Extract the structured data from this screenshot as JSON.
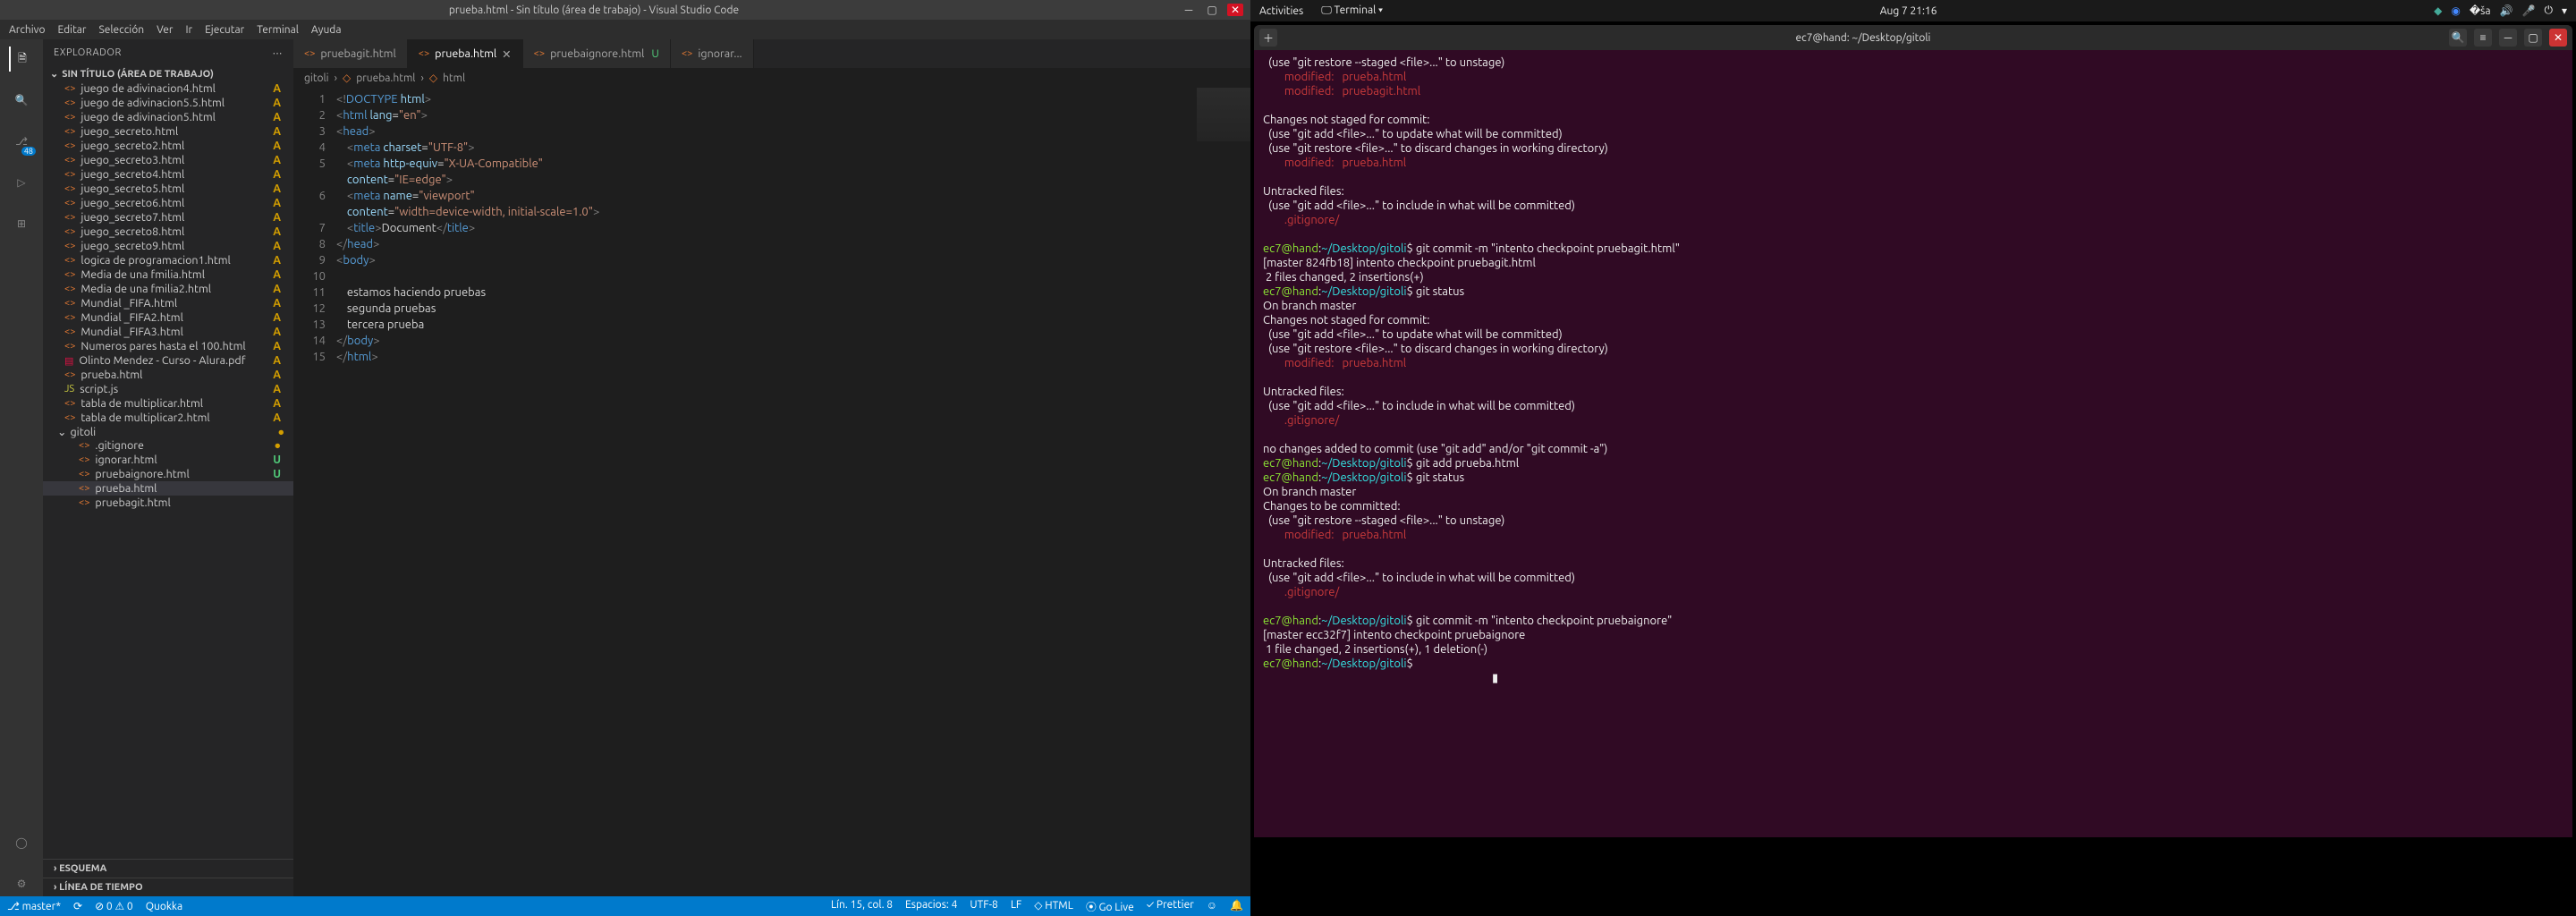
{
  "vscode": {
    "title": "prueba.html - Sin título (área de trabajo) - Visual Studio Code",
    "menus": [
      "Archivo",
      "Editar",
      "Selección",
      "Ver",
      "Ir",
      "Ejecutar",
      "Terminal",
      "Ayuda"
    ],
    "scm_badge": "48",
    "explorer_label": "EXPLORADOR",
    "workspace_label": "SIN TÍTULO (ÁREA DE TRABAJO)",
    "files": [
      {
        "name": "juego de adivinacion4.html",
        "status": "A"
      },
      {
        "name": "juego de adivinacion5.5.html",
        "status": "A"
      },
      {
        "name": "juego de adivinacion5.html",
        "status": "A"
      },
      {
        "name": "juego_secreto.html",
        "status": "A"
      },
      {
        "name": "juego_secreto2.html",
        "status": "A"
      },
      {
        "name": "juego_secreto3.html",
        "status": "A"
      },
      {
        "name": "juego_secreto4.html",
        "status": "A"
      },
      {
        "name": "juego_secreto5.html",
        "status": "A"
      },
      {
        "name": "juego_secreto6.html",
        "status": "A"
      },
      {
        "name": "juego_secreto7.html",
        "status": "A"
      },
      {
        "name": "juego_secreto8.html",
        "status": "A"
      },
      {
        "name": "juego_secreto9.html",
        "status": "A"
      },
      {
        "name": "logica de programacion1.html",
        "status": "A"
      },
      {
        "name": "Media de una fmilia.html",
        "status": "A"
      },
      {
        "name": "Media de una fmilia2.html",
        "status": "A"
      },
      {
        "name": "Mundial _FIFA.html",
        "status": "A"
      },
      {
        "name": "Mundial _FIFA2.html",
        "status": "A"
      },
      {
        "name": "Mundial _FIFA3.html",
        "status": "A"
      },
      {
        "name": "Numeros pares hasta el 100.html",
        "status": "A"
      },
      {
        "name": "Olinto Mendez - Curso - Alura.pdf",
        "status": "A",
        "icon": "pdf"
      },
      {
        "name": "prueba.html",
        "status": "A"
      },
      {
        "name": "script.js",
        "status": "A",
        "icon": "js"
      },
      {
        "name": "tabla de multiplicar.html",
        "status": "A"
      },
      {
        "name": "tabla de multiplicar2.html",
        "status": "A"
      }
    ],
    "gitoli_folder": "gitoli",
    "gitoli_files": [
      {
        "name": ".gitignore",
        "status": "●",
        "cls": "dot"
      },
      {
        "name": "ignorar.html",
        "status": "U",
        "cls": "U"
      },
      {
        "name": "pruebaignore.html",
        "status": "U",
        "cls": "U"
      },
      {
        "name": "prueba.html",
        "status": "",
        "selected": true
      },
      {
        "name": "pruebagit.html",
        "status": ""
      }
    ],
    "outline": "ESQUEMA",
    "timeline": "LÍNEA DE TIEMPO",
    "tabs": [
      {
        "label": "pruebagit.html",
        "active": false
      },
      {
        "label": "prueba.html",
        "active": true,
        "close": true
      },
      {
        "label": "pruebaignore.html",
        "mod": "U",
        "active": false
      },
      {
        "label": "ignorar...",
        "active": false
      }
    ],
    "breadcrumb": [
      "gitoli",
      "prueba.html",
      "html"
    ],
    "code_lines": [
      {
        "n": "1",
        "seg": [
          [
            "gray",
            "<!"
          ],
          [
            "blue",
            "DOCTYPE "
          ],
          [
            "lb",
            "html"
          ],
          [
            "gray",
            ">"
          ]
        ]
      },
      {
        "n": "2",
        "seg": [
          [
            "gray",
            "<"
          ],
          [
            "blue",
            "html "
          ],
          [
            "lb",
            "lang"
          ],
          [
            "txt",
            "="
          ],
          [
            "str",
            "\"en\""
          ],
          [
            "gray",
            ">"
          ]
        ]
      },
      {
        "n": "3",
        "seg": [
          [
            "gray",
            "<"
          ],
          [
            "blue",
            "head"
          ],
          [
            "gray",
            ">"
          ]
        ]
      },
      {
        "n": "4",
        "seg": [
          [
            "txt",
            "    "
          ],
          [
            "gray",
            "<"
          ],
          [
            "blue",
            "meta "
          ],
          [
            "lb",
            "charset"
          ],
          [
            "txt",
            "="
          ],
          [
            "str",
            "\"UTF-8\""
          ],
          [
            "gray",
            ">"
          ]
        ]
      },
      {
        "n": "5",
        "seg": [
          [
            "txt",
            "    "
          ],
          [
            "gray",
            "<"
          ],
          [
            "blue",
            "meta "
          ],
          [
            "lb",
            "http-equiv"
          ],
          [
            "txt",
            "="
          ],
          [
            "str",
            "\"X-UA-Compatible\""
          ]
        ]
      },
      {
        "n": "",
        "seg": [
          [
            "txt",
            "    "
          ],
          [
            "lb",
            "content"
          ],
          [
            "txt",
            "="
          ],
          [
            "str",
            "\"IE=edge\""
          ],
          [
            "gray",
            ">"
          ]
        ]
      },
      {
        "n": "6",
        "seg": [
          [
            "txt",
            "    "
          ],
          [
            "gray",
            "<"
          ],
          [
            "blue",
            "meta "
          ],
          [
            "lb",
            "name"
          ],
          [
            "txt",
            "="
          ],
          [
            "str",
            "\"viewport\""
          ]
        ]
      },
      {
        "n": "",
        "seg": [
          [
            "txt",
            "    "
          ],
          [
            "lb",
            "content"
          ],
          [
            "txt",
            "="
          ],
          [
            "str",
            "\"width=device-width, initial-scale=1.0\""
          ],
          [
            "gray",
            ">"
          ]
        ]
      },
      {
        "n": "7",
        "seg": [
          [
            "txt",
            "    "
          ],
          [
            "gray",
            "<"
          ],
          [
            "blue",
            "title"
          ],
          [
            "gray",
            ">"
          ],
          [
            "txt",
            "Document"
          ],
          [
            "gray",
            "</"
          ],
          [
            "blue",
            "title"
          ],
          [
            "gray",
            ">"
          ]
        ]
      },
      {
        "n": "8",
        "seg": [
          [
            "gray",
            "</"
          ],
          [
            "blue",
            "head"
          ],
          [
            "gray",
            ">"
          ]
        ]
      },
      {
        "n": "9",
        "seg": [
          [
            "gray",
            "<"
          ],
          [
            "blue",
            "body"
          ],
          [
            "gray",
            ">"
          ]
        ]
      },
      {
        "n": "10",
        "seg": [
          [
            "txt",
            ""
          ]
        ]
      },
      {
        "n": "11",
        "seg": [
          [
            "txt",
            "    estamos haciendo pruebas"
          ]
        ]
      },
      {
        "n": "12",
        "seg": [
          [
            "txt",
            "    segunda pruebas"
          ]
        ]
      },
      {
        "n": "13",
        "seg": [
          [
            "txt",
            "    tercera prueba"
          ]
        ]
      },
      {
        "n": "14",
        "seg": [
          [
            "gray",
            "</"
          ],
          [
            "blue",
            "body"
          ],
          [
            "gray",
            ">"
          ]
        ]
      },
      {
        "n": "15",
        "seg": [
          [
            "gray",
            "</"
          ],
          [
            "blue",
            "html"
          ],
          [
            "gray",
            ">"
          ]
        ]
      }
    ],
    "status": {
      "branch": "master*",
      "sync": "⟳",
      "errors": "⊘ 0 ⚠ 0",
      "quokka": "Quokka",
      "pos": "Lín. 15, col. 8",
      "spaces": "Espacios: 4",
      "enc": "UTF-8",
      "eol": "LF",
      "lang": "HTML",
      "live": "⦿ Go Live",
      "prettier": "✓ Prettier"
    }
  },
  "gnome": {
    "activities": "Activities",
    "terminal_app": "Terminal",
    "clock": "Aug 7  21:16",
    "term_title": "ec7@hand: ~/Desktop/gitoli",
    "lines": [
      [
        [
          "white",
          "  (use \"git restore --staged <file>...\" to unstage)"
        ]
      ],
      [
        [
          "red",
          "        modified:   "
        ],
        [
          "red",
          "prueba.html"
        ]
      ],
      [
        [
          "red",
          "        modified:   "
        ],
        [
          "red",
          "pruebagit.html"
        ]
      ],
      [
        [
          "white",
          ""
        ]
      ],
      [
        [
          "white",
          "Changes not staged for commit:"
        ]
      ],
      [
        [
          "white",
          "  (use \"git add <file>...\" to update what will be committed)"
        ]
      ],
      [
        [
          "white",
          "  (use \"git restore <file>...\" to discard changes in working directory)"
        ]
      ],
      [
        [
          "red",
          "        modified:   prueba.html"
        ]
      ],
      [
        [
          "white",
          ""
        ]
      ],
      [
        [
          "white",
          "Untracked files:"
        ]
      ],
      [
        [
          "white",
          "  (use \"git add <file>...\" to include in what will be committed)"
        ]
      ],
      [
        [
          "red",
          "        .gitignore/"
        ]
      ],
      [
        [
          "white",
          ""
        ]
      ],
      [
        [
          "green",
          "ec7@hand"
        ],
        [
          "white",
          ":"
        ],
        [
          "cyan",
          "~/Desktop/gitoli"
        ],
        [
          "white",
          "$ git commit -m \"intento checkpoint pruebagit.html\""
        ]
      ],
      [
        [
          "white",
          "[master 824fb18] intento checkpoint pruebagit.html"
        ]
      ],
      [
        [
          "white",
          " 2 files changed, 2 insertions(+)"
        ]
      ],
      [
        [
          "green",
          "ec7@hand"
        ],
        [
          "white",
          ":"
        ],
        [
          "cyan",
          "~/Desktop/gitoli"
        ],
        [
          "white",
          "$ git status"
        ]
      ],
      [
        [
          "white",
          "On branch master"
        ]
      ],
      [
        [
          "white",
          "Changes not staged for commit:"
        ]
      ],
      [
        [
          "white",
          "  (use \"git add <file>...\" to update what will be committed)"
        ]
      ],
      [
        [
          "white",
          "  (use \"git restore <file>...\" to discard changes in working directory)"
        ]
      ],
      [
        [
          "red",
          "        modified:   prueba.html"
        ]
      ],
      [
        [
          "white",
          ""
        ]
      ],
      [
        [
          "white",
          "Untracked files:"
        ]
      ],
      [
        [
          "white",
          "  (use \"git add <file>...\" to include in what will be committed)"
        ]
      ],
      [
        [
          "red",
          "        .gitignore/"
        ]
      ],
      [
        [
          "white",
          ""
        ]
      ],
      [
        [
          "white",
          "no changes added to commit (use \"git add\" and/or \"git commit -a\")"
        ]
      ],
      [
        [
          "green",
          "ec7@hand"
        ],
        [
          "white",
          ":"
        ],
        [
          "cyan",
          "~/Desktop/gitoli"
        ],
        [
          "white",
          "$ git add prueba.html"
        ]
      ],
      [
        [
          "green",
          "ec7@hand"
        ],
        [
          "white",
          ":"
        ],
        [
          "cyan",
          "~/Desktop/gitoli"
        ],
        [
          "white",
          "$ git status"
        ]
      ],
      [
        [
          "white",
          "On branch master"
        ]
      ],
      [
        [
          "white",
          "Changes to be committed:"
        ]
      ],
      [
        [
          "white",
          "  (use \"git restore --staged <file>...\" to unstage)"
        ]
      ],
      [
        [
          "red",
          "        modified:   "
        ],
        [
          "red",
          "prueba.html"
        ]
      ],
      [
        [
          "white",
          ""
        ]
      ],
      [
        [
          "white",
          "Untracked files:"
        ]
      ],
      [
        [
          "white",
          "  (use \"git add <file>...\" to include in what will be committed)"
        ]
      ],
      [
        [
          "red",
          "        .gitignore/"
        ]
      ],
      [
        [
          "white",
          ""
        ]
      ],
      [
        [
          "green",
          "ec7@hand"
        ],
        [
          "white",
          ":"
        ],
        [
          "cyan",
          "~/Desktop/gitoli"
        ],
        [
          "white",
          "$ git commit -m \"intento checkpoint pruebaignore\""
        ]
      ],
      [
        [
          "white",
          "[master ecc32f7] intento checkpoint pruebaignore"
        ]
      ],
      [
        [
          "white",
          " 1 file changed, 2 insertions(+), 1 deletion(-)"
        ]
      ],
      [
        [
          "green",
          "ec7@hand"
        ],
        [
          "white",
          ":"
        ],
        [
          "cyan",
          "~/Desktop/gitoli"
        ],
        [
          "white",
          "$ "
        ]
      ],
      [
        [
          "white",
          "                                                                                      ▮"
        ]
      ]
    ]
  }
}
